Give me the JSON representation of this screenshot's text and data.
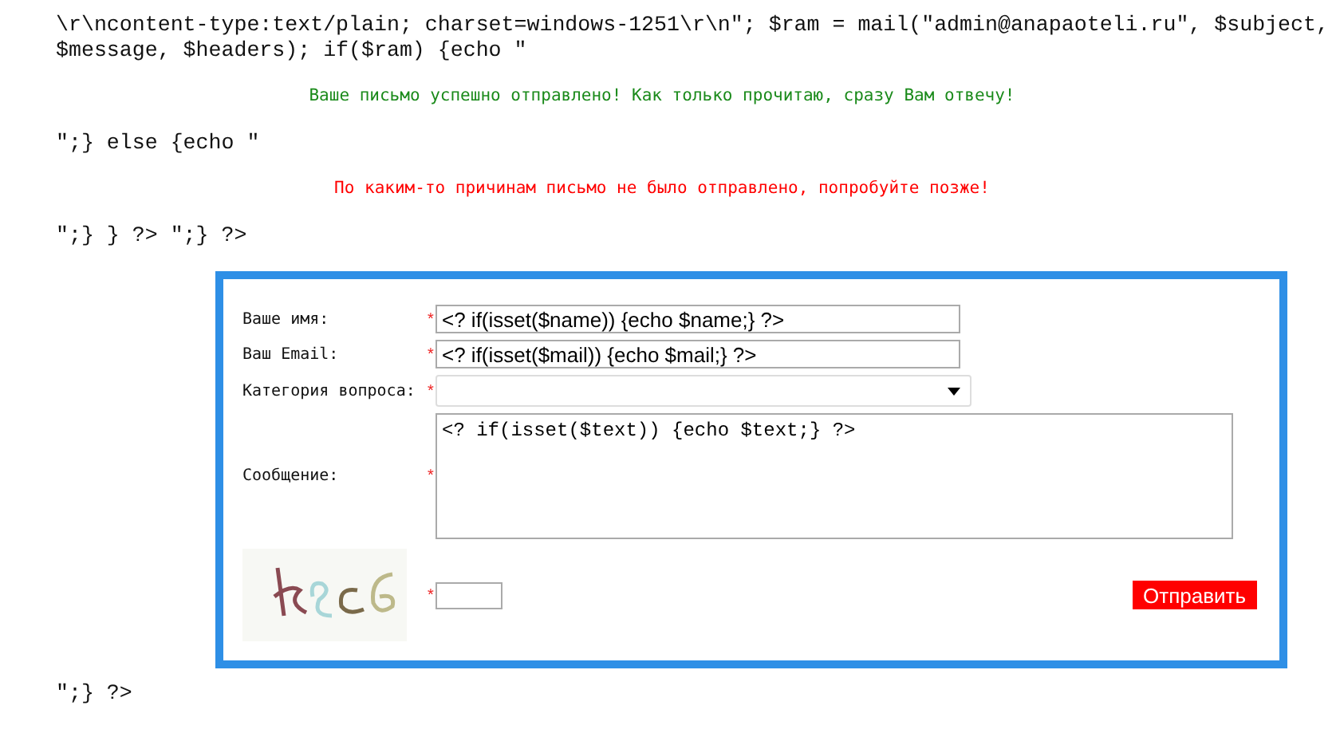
{
  "code_before": [
    "\\r\\ncontent-type:text/plain; charset=windows-1251\\r\\n\"; $ram = mail(\"admin@anapaoteli.ru\", $subject,",
    "$message, $headers); if($ram) {echo \""
  ],
  "success_message": "Ваше письмо успешно отправлено! Как только прочитаю, сразу Вам отвечу!",
  "code_middle": "\";} else {echo \"",
  "error_message": "По каким-то причинам письмо не было отправлено, попробуйте позже!",
  "code_after": "\";} } ?> \";} ?>",
  "form": {
    "fields": [
      {
        "kind": "text",
        "label": "Ваше имя:",
        "required_mark": "*",
        "value": "<? if(isset($name)) {echo $name;} ?>"
      },
      {
        "kind": "text",
        "label": "Ваш Email:",
        "required_mark": "*",
        "value": "<? if(isset($mail)) {echo $mail;} ?>"
      },
      {
        "kind": "select",
        "label": "Категория вопроса:",
        "required_mark": "*"
      },
      {
        "kind": "textarea",
        "label": "Сообщение:",
        "required_mark": "*",
        "value": "<? if(isset($text)) {echo $text;} ?>"
      }
    ],
    "captcha": {
      "kind": "picture",
      "required_mark": "*"
    },
    "submit": "Отправить"
  },
  "code_end": "\";} ?>"
}
